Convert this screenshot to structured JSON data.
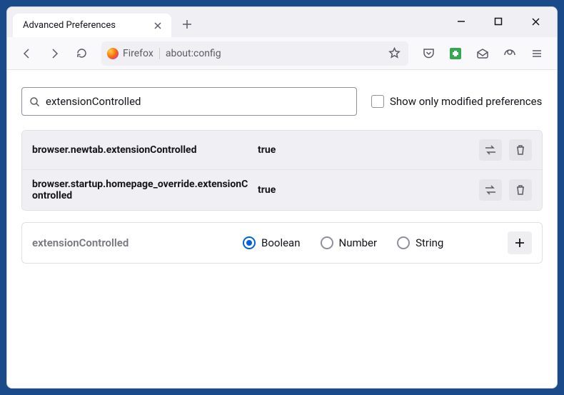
{
  "window": {
    "tab_title": "Advanced Preferences"
  },
  "urlbar": {
    "identity_label": "Firefox",
    "url": "about:config"
  },
  "search": {
    "value": "extensionControlled",
    "checkbox_label": "Show only modified preferences"
  },
  "prefs": [
    {
      "name": "browser.newtab.extensionControlled",
      "value": "true"
    },
    {
      "name": "browser.startup.homepage_override.extensionControlled",
      "value": "true"
    }
  ],
  "add": {
    "name": "extensionControlled",
    "type_boolean": "Boolean",
    "type_number": "Number",
    "type_string": "String",
    "selected": "Boolean"
  }
}
